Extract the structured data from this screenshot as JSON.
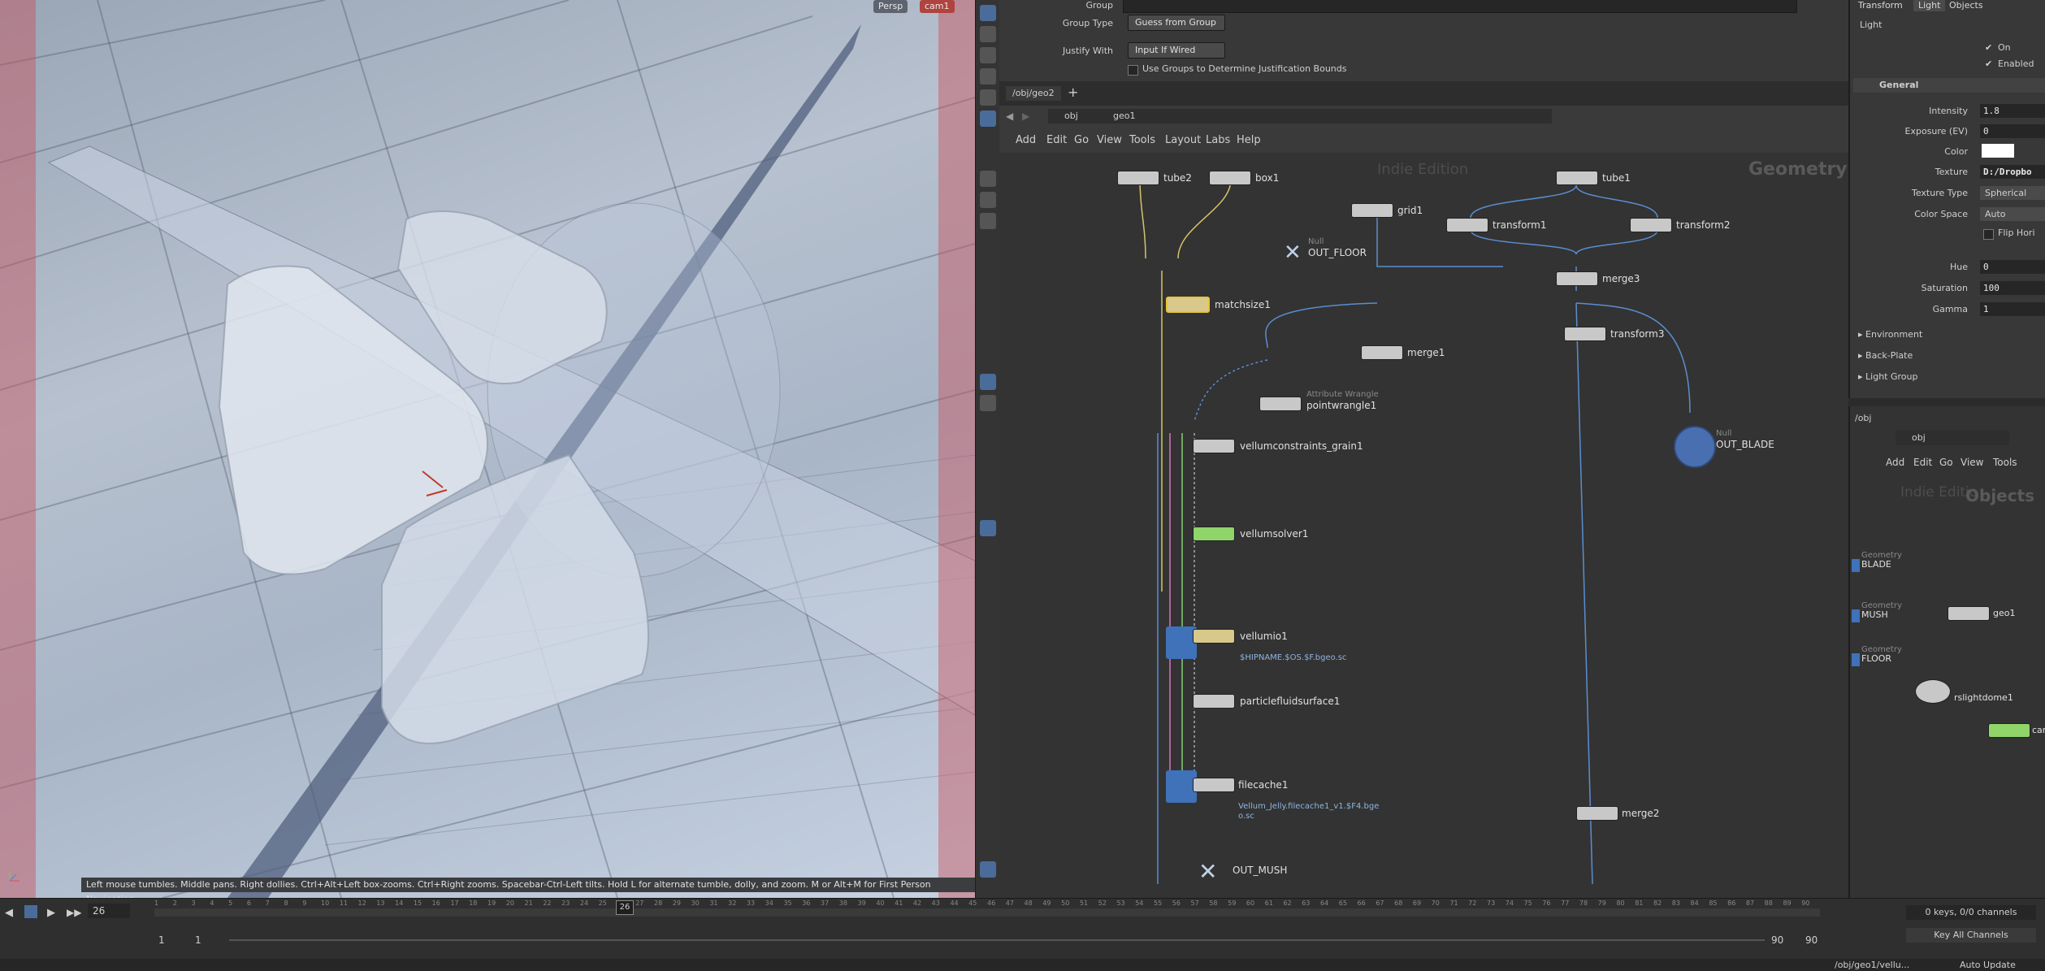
{
  "viewport": {
    "camera_menu": "Persp",
    "camera_name": "cam1",
    "status_hint": "Left mouse tumbles. Middle pans. Right dollies. Ctrl+Alt+Left box-zooms. Ctrl+Right zooms. Spacebar-Ctrl-Left tilts. Hold L for alternate tumble, dolly, and zoom.    M or Alt+M for First Person Navigation."
  },
  "parm_pane": {
    "rows": [
      {
        "label": "Group",
        "value": ""
      },
      {
        "label": "Group Type",
        "value": "Guess from Group"
      },
      {
        "label": "Justify With",
        "value": "Input If Wired"
      }
    ],
    "checkbox_label": "Use Groups to Determine Justification Bounds"
  },
  "network": {
    "tab": "/obj/geo2",
    "path_root": "obj",
    "path_current": "geo1",
    "menus": [
      "Add",
      "Edit",
      "Go",
      "View",
      "Tools",
      "Layout",
      "Labs",
      "Help"
    ],
    "watermark": "Indie Edition",
    "context_label": "Geometry",
    "nodes": {
      "tube2": "tube2",
      "box1": "box1",
      "grid1": "grid1",
      "tube1": "tube1",
      "out_floor": "OUT_FLOOR",
      "out_floor_type": "Null",
      "transform1": "transform1",
      "transform2": "transform2",
      "matchsize1": "matchsize1",
      "merge3": "merge3",
      "merge1": "merge1",
      "transform3": "transform3",
      "pointwrangle1": "pointwrangle1",
      "pointwrangle1_type": "Attribute Wrangle",
      "out_blade": "OUT_BLADE",
      "out_blade_type": "Null",
      "vellumconstraints": "vellumconstraints_grain1",
      "vellumsolver1": "vellumsolver1",
      "vellumio1": "vellumio1",
      "vellumio1_path": "$HIPNAME.$OS.$F.bgeo.sc",
      "particlefluidsurface1": "particlefluidsurface1",
      "filecache1": "filecache1",
      "filecache1_path": "Vellum_Jelly.filecache1_v1.$F4.bge",
      "filecache1_path2": "o.sc",
      "merge2": "merge2",
      "out_mush": "OUT_MUSH"
    }
  },
  "right_parms": {
    "tabs": [
      "Transform",
      "Light",
      "Objects"
    ],
    "subtab": "Light",
    "on_label": "On",
    "enabled_label": "Enabled",
    "section_general": "General",
    "fields": [
      {
        "label": "Intensity",
        "value": "1.8"
      },
      {
        "label": "Exposure (EV)",
        "value": "0"
      },
      {
        "label": "Color",
        "value": ""
      },
      {
        "label": "Texture",
        "value": "D:/Dropbo"
      },
      {
        "label": "Texture Type",
        "value": "Spherical"
      },
      {
        "label": "Color Space",
        "value": "Auto"
      }
    ],
    "flip_label": "Flip Hori",
    "hue": {
      "label": "Hue",
      "value": "0"
    },
    "saturation": {
      "label": "Saturation",
      "value": "100"
    },
    "gamma": {
      "label": "Gamma",
      "value": "1"
    },
    "sections": [
      "Environment",
      "Back-Plate",
      "Light Group"
    ]
  },
  "right_network": {
    "tab": "/obj",
    "path": "obj",
    "menus": [
      "Add",
      "Edit",
      "Go",
      "View",
      "Tools"
    ],
    "watermark": "Indie Editio",
    "context_label": "Objects",
    "objects": [
      {
        "type": "Geometry",
        "name": "BLADE"
      },
      {
        "type": "Geometry",
        "name": "MUSH"
      },
      {
        "type": "Geometry",
        "name": "FLOOR"
      }
    ],
    "geo1": "geo1",
    "rslightdome1": "rslightdome1",
    "cam": "car"
  },
  "timeline": {
    "current_frame": "26",
    "frame_marker": "26",
    "start": "1",
    "start2": "1",
    "end": "90",
    "end2": "90",
    "ticks": [
      "1",
      "2",
      "3",
      "4",
      "5",
      "6",
      "7",
      "8",
      "9",
      "10",
      "11",
      "12",
      "13",
      "14",
      "15",
      "16",
      "17",
      "18",
      "19",
      "20",
      "21",
      "22",
      "23",
      "24",
      "25",
      "26",
      "27",
      "28",
      "29",
      "30",
      "31",
      "32",
      "33",
      "34",
      "35",
      "36",
      "37",
      "38",
      "39",
      "40",
      "41",
      "42",
      "43",
      "44",
      "45",
      "46",
      "47",
      "48",
      "49",
      "50",
      "51",
      "52",
      "53",
      "54",
      "55",
      "56",
      "57",
      "58",
      "59",
      "60",
      "61",
      "62",
      "63",
      "64",
      "65",
      "66",
      "67",
      "68",
      "69",
      "70",
      "71",
      "72",
      "73",
      "74",
      "75",
      "76",
      "77",
      "78",
      "79",
      "80",
      "81",
      "82",
      "83",
      "84",
      "85",
      "86",
      "87",
      "88",
      "89",
      "90"
    ],
    "keys_label": "0 keys, 0/0 channels",
    "key_all": "Key All Channels"
  },
  "status": {
    "path": "/obj/geo1/vellu...",
    "update": "Auto Update"
  }
}
